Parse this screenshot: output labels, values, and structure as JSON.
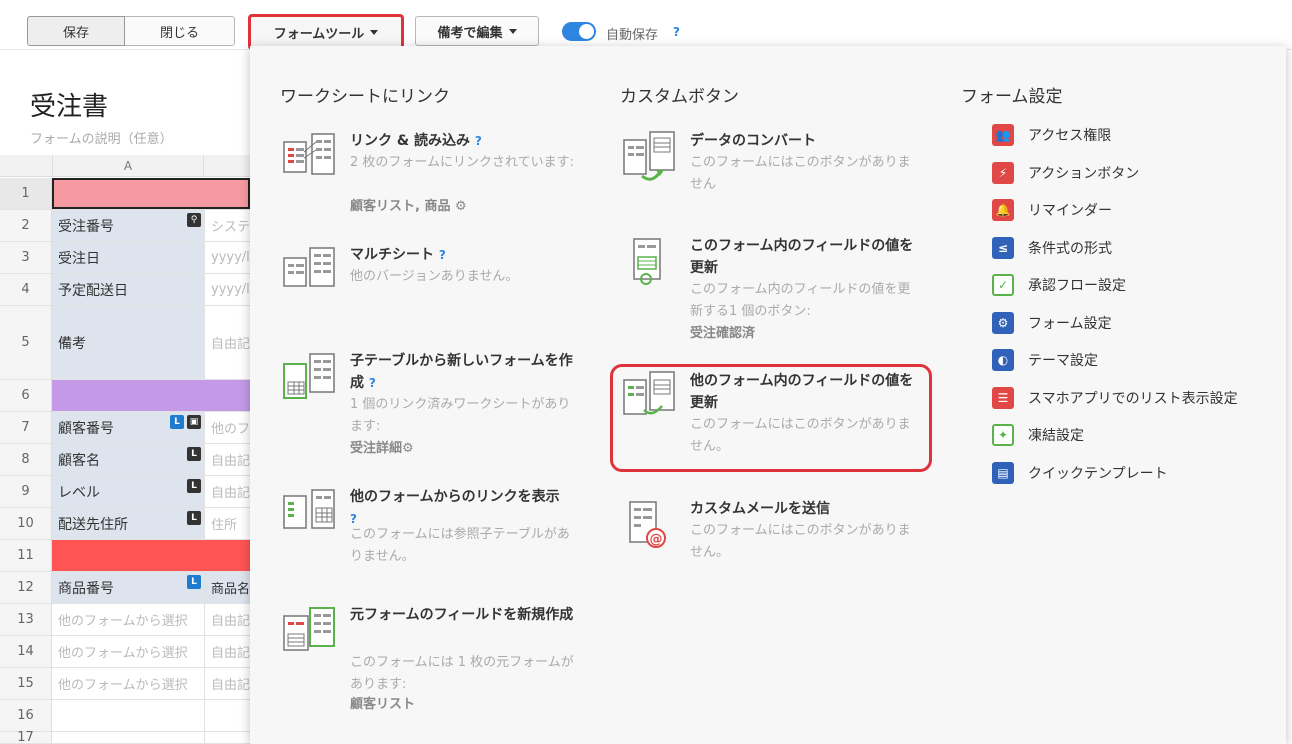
{
  "toolbar": {
    "save_label": "保存",
    "close_label": "閉じる",
    "formtool_label": "フォームツール",
    "biko_label": "備考で編集",
    "autosave_label": "自動保存",
    "help": "?"
  },
  "sheet": {
    "title": "受注書",
    "description": "フォームの説明（任意）",
    "column_a": "A",
    "rows": [
      {
        "n": "1",
        "a": "",
        "b": ""
      },
      {
        "n": "2",
        "a": "受注番号",
        "b": "システ"
      },
      {
        "n": "3",
        "a": "受注日",
        "b": "yyyy/l"
      },
      {
        "n": "4",
        "a": "予定配送日",
        "b": "yyyy/l"
      },
      {
        "n": "5",
        "a": "備考",
        "b": "自由記"
      },
      {
        "n": "6",
        "a": "",
        "b": ""
      },
      {
        "n": "7",
        "a": "顧客番号",
        "b": "他のフ"
      },
      {
        "n": "8",
        "a": "顧客名",
        "b": "自由記"
      },
      {
        "n": "9",
        "a": "レベル",
        "b": "自由記"
      },
      {
        "n": "10",
        "a": "配送先住所",
        "b": "住所"
      },
      {
        "n": "11",
        "a": "",
        "b": ""
      },
      {
        "n": "12",
        "a": "商品番号",
        "b": "商品名"
      },
      {
        "n": "13",
        "a": "他のフォームから選択",
        "b": "自由記"
      },
      {
        "n": "14",
        "a": "他のフォームから選択",
        "b": "自由記"
      },
      {
        "n": "15",
        "a": "他のフォームから選択",
        "b": "自由記"
      },
      {
        "n": "16",
        "a": "",
        "b": ""
      },
      {
        "n": "17",
        "a": "",
        "b": ""
      }
    ],
    "tag_l": "L"
  },
  "panel": {
    "col1_title": "ワークシートにリンク",
    "col2_title": "カスタムボタン",
    "col3_title": "フォーム設定",
    "link_read": {
      "title": "リンク & 読み込み",
      "desc": "2 枚のフォームにリンクされています:",
      "links": "顧客リスト, 商品"
    },
    "multisheet": {
      "title": "マルチシート",
      "desc": "他のバージョンありません。"
    },
    "child_table": {
      "title": "子テーブルから新しいフォームを作成",
      "desc": "1 個のリンク済みワークシートがあります:",
      "links": "受注詳細"
    },
    "show_links": {
      "title": "他のフォームからのリンクを表示",
      "desc": "このフォームには参照子テーブルがありません。"
    },
    "new_field": {
      "title": "元フォームのフィールドを新規作成",
      "desc": "このフォームには 1 枚の元フォームがあります:",
      "links": "顧客リスト"
    },
    "convert": {
      "title": "データのコンバート",
      "desc": "このフォームにはこのボタンがありません"
    },
    "update_this": {
      "title": "このフォーム内のフィールドの値を更新",
      "desc": "このフォーム内のフィールドの値を更新する1 個のボタン:",
      "links": "受注確認済"
    },
    "update_other": {
      "title": "他のフォーム内のフィールドの値を更新",
      "desc": "このフォームにはこのボタンがありません。"
    },
    "custom_mail": {
      "title": "カスタムメールを送信",
      "desc": "このフォームにはこのボタンがありません。"
    },
    "settings": [
      {
        "label": "アクセス権限",
        "color": "#e04848",
        "icon": "users-icon"
      },
      {
        "label": "アクションボタン",
        "color": "#e04848",
        "icon": "lightning-icon"
      },
      {
        "label": "リマインダー",
        "color": "#e04848",
        "icon": "bell-icon"
      },
      {
        "label": "条件式の形式",
        "color": "#2f62b8",
        "icon": "condition-icon"
      },
      {
        "label": "承認フロー設定",
        "color": "#5ab34a",
        "icon": "check-icon"
      },
      {
        "label": "フォーム設定",
        "color": "#2f62b8",
        "icon": "gear-icon"
      },
      {
        "label": "テーマ設定",
        "color": "#2f62b8",
        "icon": "palette-icon"
      },
      {
        "label": "スマホアプリでのリスト表示設定",
        "color": "#e04848",
        "icon": "list-icon"
      },
      {
        "label": "凍結設定",
        "color": "#5ab34a",
        "icon": "pin-icon"
      },
      {
        "label": "クイックテンプレート",
        "color": "#2f62b8",
        "icon": "document-icon"
      }
    ]
  }
}
